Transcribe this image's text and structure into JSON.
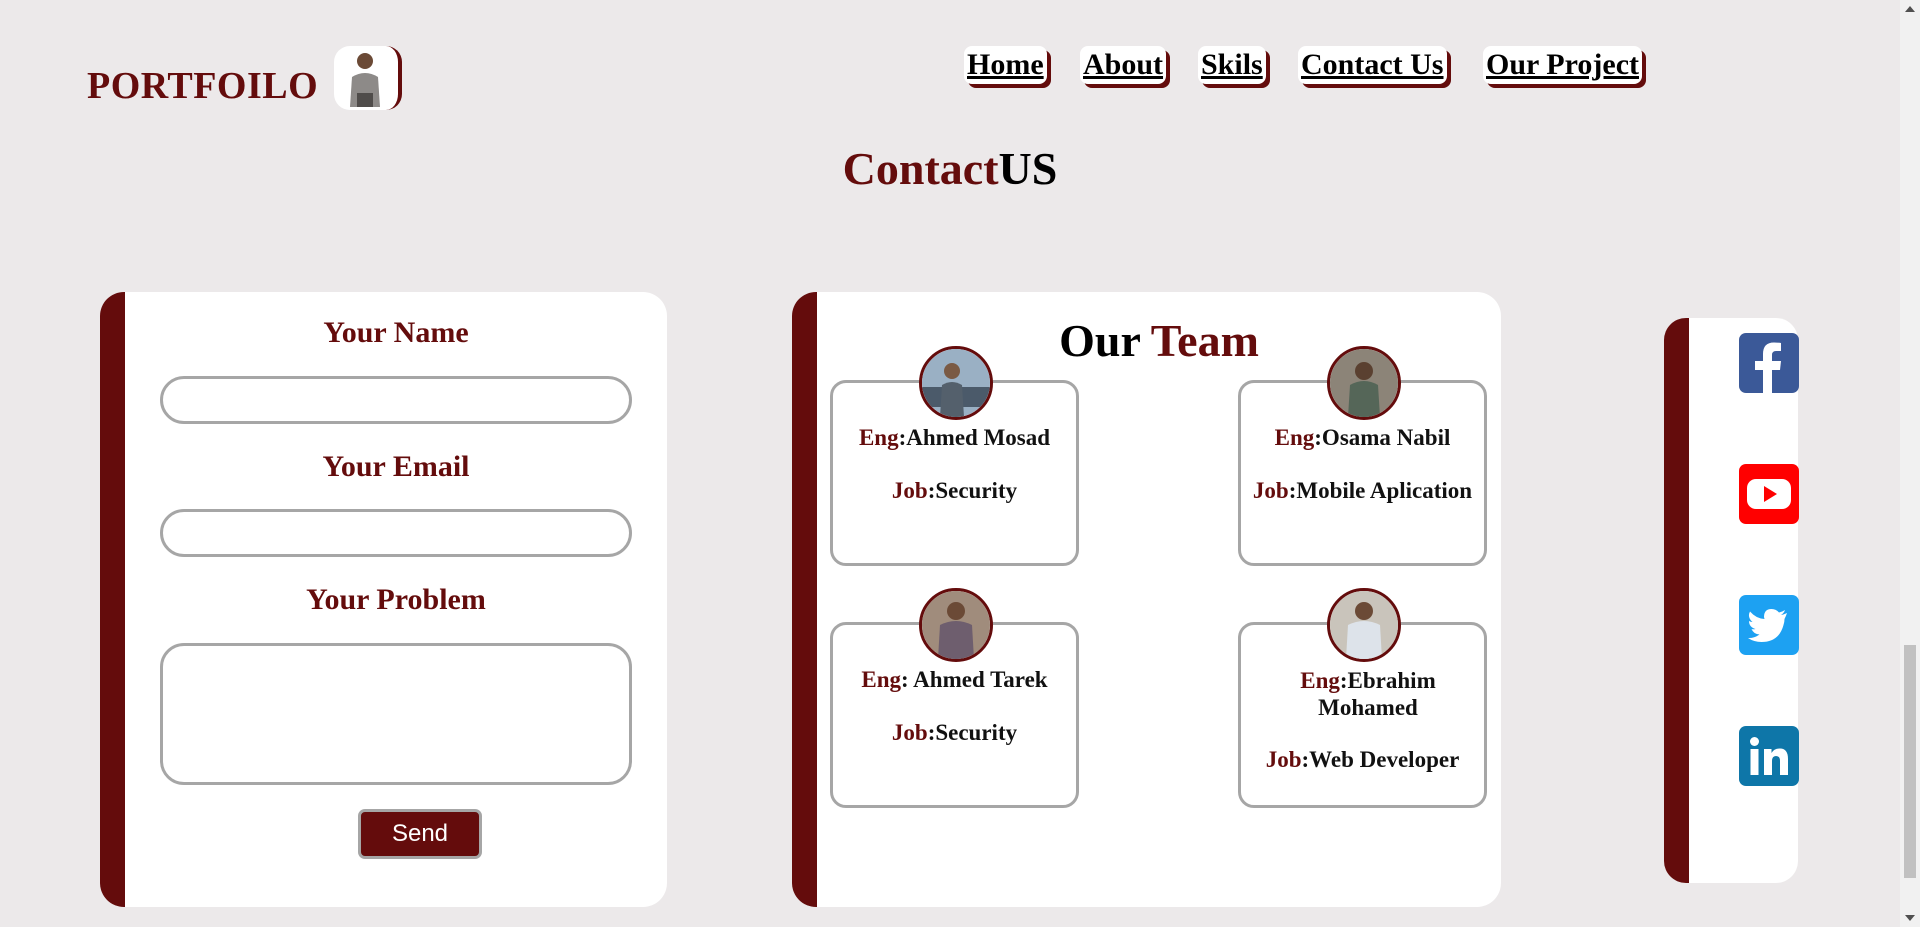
{
  "header": {
    "logo": "PORTFOILO",
    "nav": [
      "Home",
      "About",
      "Skils",
      "Contact Us",
      "Our Project"
    ]
  },
  "title": {
    "part1": "Contact",
    "part2": "US"
  },
  "form": {
    "name_label": "Your Name",
    "email_label": "Your Email",
    "problem_label": "Your Problem",
    "name_value": "",
    "email_value": "",
    "problem_value": "",
    "send_label": "Send"
  },
  "team": {
    "title_part1": "Our",
    "title_part2": "Team",
    "eng_key": "Eng",
    "job_key": "Job",
    "members": [
      {
        "eng": ":Ahmed Mosad",
        "job": ":Security"
      },
      {
        "eng": ":Osama Nabil",
        "job": ":Mobile Aplication"
      },
      {
        "eng": ": Ahmed Tarek",
        "job": ":Security"
      },
      {
        "eng": ":Ebrahim Mohamed",
        "job": ":Web Developer"
      }
    ]
  },
  "social": {
    "icons": [
      "facebook-icon",
      "youtube-icon",
      "twitter-icon",
      "linkedin-icon"
    ]
  },
  "colors": {
    "accent": "#640c0c",
    "background": "#ece9ea",
    "facebook": "#3b5998",
    "youtube": "#ff0000",
    "twitter": "#1da1f2",
    "linkedin": "#0e76a8"
  }
}
